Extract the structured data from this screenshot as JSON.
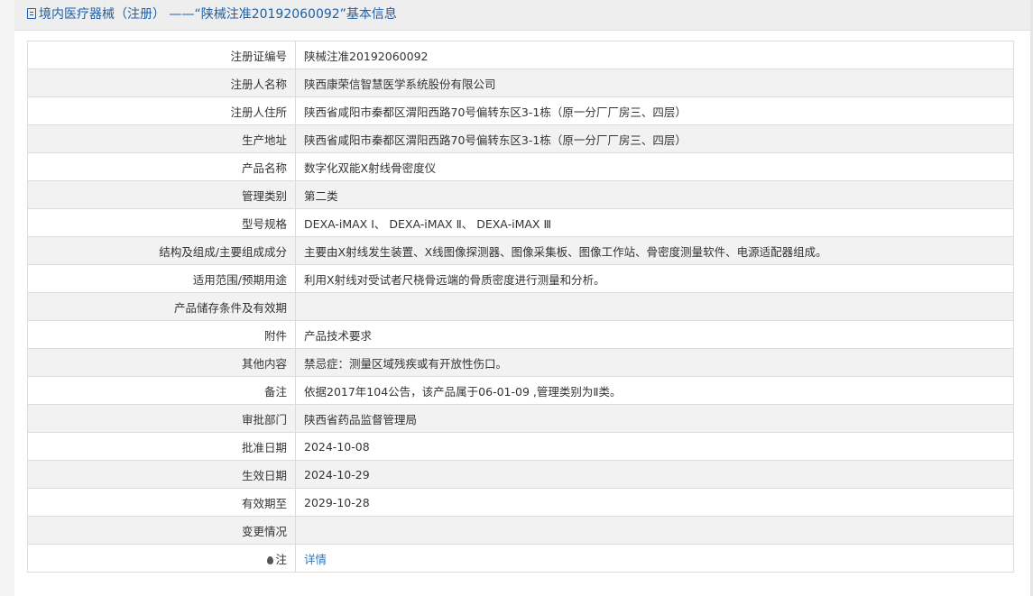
{
  "header": {
    "title": "境内医疗器械（注册） ——“陕械注准20192060092”基本信息"
  },
  "rows": [
    {
      "label": "注册证编号",
      "value": "陕械注准20192060092"
    },
    {
      "label": "注册人名称",
      "value": "陕西康荣信智慧医学系统股份有限公司"
    },
    {
      "label": "注册人住所",
      "value": "陕西省咸阳市秦都区渭阳西路70号偏转东区3-1栋（原一分厂厂房三、四层）"
    },
    {
      "label": "生产地址",
      "value": "陕西省咸阳市秦都区渭阳西路70号偏转东区3-1栋（原一分厂厂房三、四层）"
    },
    {
      "label": "产品名称",
      "value": "数字化双能X射线骨密度仪"
    },
    {
      "label": "管理类别",
      "value": "第二类"
    },
    {
      "label": "型号规格",
      "value": "DEXA-iMAX Ⅰ、 DEXA-iMAX Ⅱ、 DEXA-iMAX Ⅲ"
    },
    {
      "label": "结构及组成/主要组成成分",
      "value": "主要由X射线发生装置、X线图像探测器、图像采集板、图像工作站、骨密度测量软件、电源适配器组成。"
    },
    {
      "label": "适用范围/预期用途",
      "value": "利用X射线对受试者尺桡骨远端的骨质密度进行测量和分析。"
    },
    {
      "label": "产品储存条件及有效期",
      "value": ""
    },
    {
      "label": "附件",
      "value": "产品技术要求"
    },
    {
      "label": "其他内容",
      "value": "禁忌症：测量区域残疾或有开放性伤口。"
    },
    {
      "label": "备注",
      "value": "依据2017年104公告，该产品属于06-01-09 ,管理类别为Ⅱ类。"
    },
    {
      "label": "审批部门",
      "value": "陕西省药品监督管理局"
    },
    {
      "label": "批准日期",
      "value": "2024-10-08"
    },
    {
      "label": "生效日期",
      "value": "2024-10-29"
    },
    {
      "label": "有效期至",
      "value": "2029-10-28"
    },
    {
      "label": "变更情况",
      "value": ""
    }
  ],
  "note": {
    "label": "注",
    "link_text": "详情"
  },
  "colors": {
    "title": "#1f5fa8",
    "link": "#2a7ac4",
    "alt_row": "#f2f2f2",
    "border": "#dcdcdc"
  }
}
